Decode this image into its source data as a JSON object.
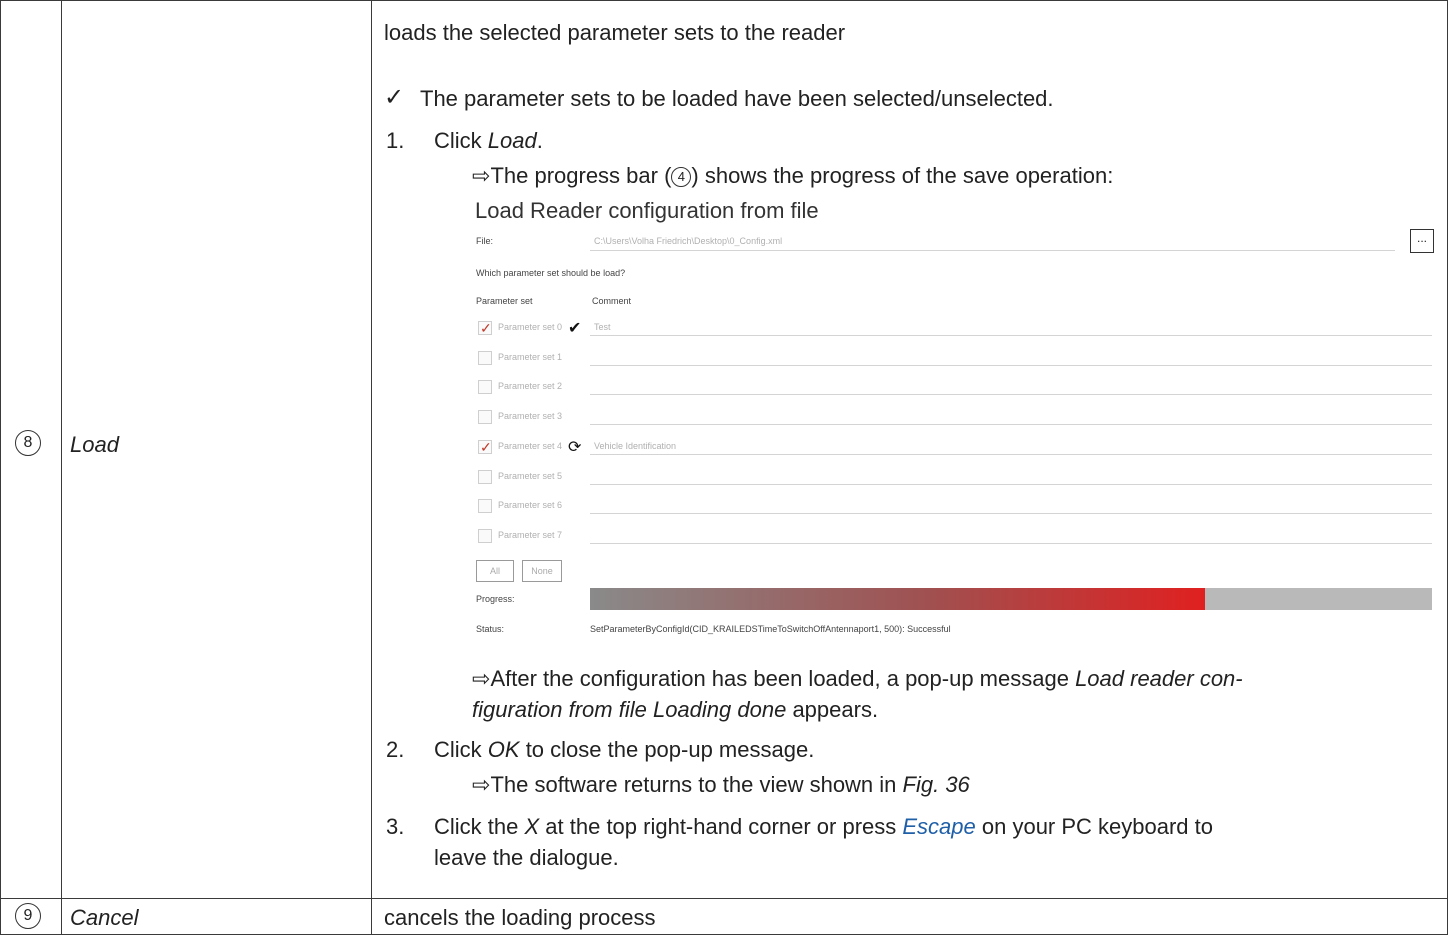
{
  "rows": [
    {
      "number": "8",
      "name": "Load",
      "desc_intro": "loads the selected parameter sets to the reader",
      "check_mark": "✓",
      "precondition": "The parameter sets to be loaded have been selected/unselected.",
      "steps": [
        {
          "num": "1.",
          "pre": "Click ",
          "em": "Load",
          "post": "."
        },
        {
          "num": "2.",
          "pre": "Click ",
          "em": "OK",
          "post": " to close the pop-up message."
        },
        {
          "num": "3.",
          "pre": "Click the ",
          "em": "X",
          "post": " at the top right-hand corner or press ",
          "link": "Escape",
          "post2": " on your PC keyboard to",
          "line2": "leave the dialogue."
        }
      ],
      "result1": {
        "arrow": "⇨",
        "pre": "The progress bar (",
        "ref": "4",
        "post": ") shows the progress of the save operation:"
      },
      "result2": {
        "arrow": "⇨",
        "pre": "After the configuration has been loaded, a pop-up message ",
        "em1": "Load reader con-",
        "em2": "figuration from file Loading done",
        "post": " appears."
      },
      "result3": {
        "arrow": "⇨",
        "pre": "The software returns to the view shown in ",
        "em": "Fig. 36"
      }
    },
    {
      "number": "9",
      "name": "Cancel",
      "desc_intro": "cancels the loading process"
    }
  ],
  "screenshot": {
    "title": "Load Reader configuration from file",
    "file_label": "File:",
    "file_path": "C:\\Users\\Volha Friedrich\\Desktop\\0_Config.xml",
    "browse_label": "...",
    "question": "Which parameter set should be load?",
    "col_param": "Parameter set",
    "col_comment": "Comment",
    "param_sets": [
      {
        "label": "Parameter set 0",
        "checked": true,
        "status": "done",
        "comment": "Test"
      },
      {
        "label": "Parameter set 1",
        "checked": false,
        "status": "",
        "comment": ""
      },
      {
        "label": "Parameter set 2",
        "checked": false,
        "status": "",
        "comment": ""
      },
      {
        "label": "Parameter set 3",
        "checked": false,
        "status": "",
        "comment": ""
      },
      {
        "label": "Parameter set 4",
        "checked": true,
        "status": "loading",
        "comment": "Vehicle Identification"
      },
      {
        "label": "Parameter set 5",
        "checked": false,
        "status": "",
        "comment": ""
      },
      {
        "label": "Parameter set 6",
        "checked": false,
        "status": "",
        "comment": ""
      },
      {
        "label": "Parameter set 7",
        "checked": false,
        "status": "",
        "comment": ""
      }
    ],
    "all_button": "All",
    "none_button": "None",
    "progress_label": "Progress:",
    "progress_fraction": 0.73,
    "status_label": "Status:",
    "status_text": "SetParameterByConfigId(CID_KRAILEDSTimeToSwitchOffAntennaport1, 500): Successful",
    "accent_color": "#e02020"
  }
}
